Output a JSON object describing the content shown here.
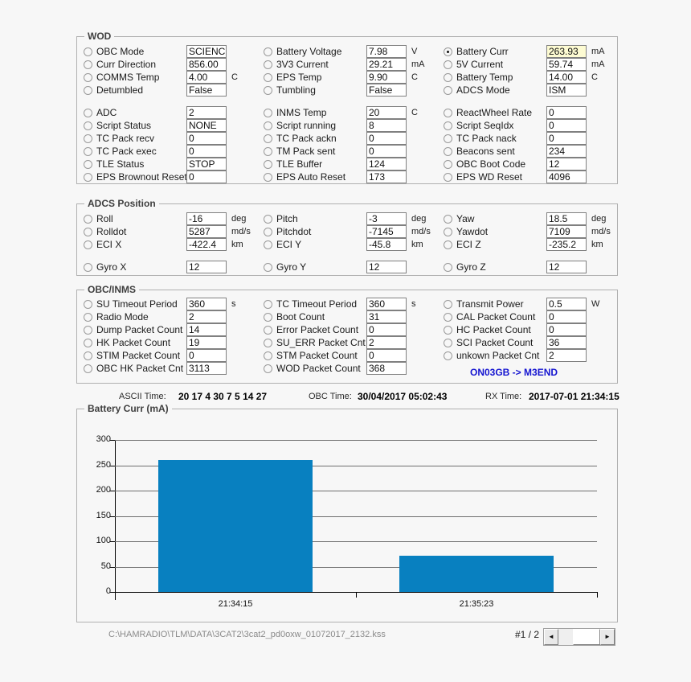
{
  "wod": {
    "legend": "WOD",
    "col1": [
      {
        "label": "OBC Mode",
        "value": "SCIENCE"
      },
      {
        "label": "Curr Direction",
        "value": "856.00"
      },
      {
        "label": "COMMS Temp",
        "value": "4.00",
        "unit": "C"
      },
      {
        "label": "Detumbled",
        "value": "False"
      },
      {
        "label": "ADC",
        "value": "2"
      },
      {
        "label": "Script Status",
        "value": "NONE"
      },
      {
        "label": "TC Pack recv",
        "value": "0"
      },
      {
        "label": "TC Pack exec",
        "value": "0"
      },
      {
        "label": "TLE Status",
        "value": "STOP"
      },
      {
        "label": "EPS Brownout Reset",
        "value": "0"
      }
    ],
    "col2": [
      {
        "label": "Battery Voltage",
        "value": "7.98",
        "unit": "V"
      },
      {
        "label": "3V3 Current",
        "value": "29.21",
        "unit": "mA"
      },
      {
        "label": "EPS Temp",
        "value": "9.90",
        "unit": "C"
      },
      {
        "label": "Tumbling",
        "value": "False"
      },
      {
        "label": "INMS Temp",
        "value": "20",
        "unit": "C"
      },
      {
        "label": "Script running",
        "value": "8"
      },
      {
        "label": "TC Pack ackn",
        "value": "0"
      },
      {
        "label": "TM Pack sent",
        "value": "0"
      },
      {
        "label": "TLE Buffer",
        "value": "124"
      },
      {
        "label": "EPS Auto Reset",
        "value": "173"
      }
    ],
    "col3": [
      {
        "label": "Battery Curr",
        "value": "263.93",
        "unit": "mA",
        "selected": true
      },
      {
        "label": "5V Current",
        "value": "59.74",
        "unit": "mA"
      },
      {
        "label": "Battery Temp",
        "value": "14.00",
        "unit": "C"
      },
      {
        "label": "ADCS Mode",
        "value": "ISM"
      },
      {
        "label": "ReactWheel Rate",
        "value": "0"
      },
      {
        "label": "Script SeqIdx",
        "value": "0"
      },
      {
        "label": "TC Pack nack",
        "value": "0"
      },
      {
        "label": "Beacons sent",
        "value": "234"
      },
      {
        "label": "OBC Boot Code",
        "value": "12"
      },
      {
        "label": "EPS WD Reset",
        "value": "4096"
      }
    ]
  },
  "adcs": {
    "legend": "ADCS Position",
    "col1": [
      {
        "label": "Roll",
        "value": "-16",
        "unit": "deg"
      },
      {
        "label": "Rolldot",
        "value": "5287",
        "unit": "md/s"
      },
      {
        "label": "ECI X",
        "value": "-422.4",
        "unit": "km"
      },
      {
        "label": "Gyro X",
        "value": "12"
      }
    ],
    "col2": [
      {
        "label": "Pitch",
        "value": "-3",
        "unit": "deg"
      },
      {
        "label": "Pitchdot",
        "value": "-7145",
        "unit": "md/s"
      },
      {
        "label": "ECI Y",
        "value": "-45.8",
        "unit": "km"
      },
      {
        "label": "Gyro Y",
        "value": "12"
      }
    ],
    "col3": [
      {
        "label": "Yaw",
        "value": "18.5",
        "unit": "deg"
      },
      {
        "label": "Yawdot",
        "value": "7109",
        "unit": "md/s"
      },
      {
        "label": "ECI Z",
        "value": "-235.2",
        "unit": "km"
      },
      {
        "label": "Gyro Z",
        "value": "12"
      }
    ]
  },
  "obcinms": {
    "legend": "OBC/INMS",
    "link": "ON03GB -> M3END",
    "col1": [
      {
        "label": "SU Timeout Period",
        "value": "360",
        "unit": "s"
      },
      {
        "label": "Radio Mode",
        "value": "2"
      },
      {
        "label": "Dump Packet Count",
        "value": "14"
      },
      {
        "label": "HK Packet Count",
        "value": "19"
      },
      {
        "label": "STIM Packet Count",
        "value": "0"
      },
      {
        "label": "OBC HK Packet Cnt",
        "value": "3113"
      }
    ],
    "col2": [
      {
        "label": "TC Timeout Period",
        "value": "360",
        "unit": "s"
      },
      {
        "label": "Boot Count",
        "value": "31"
      },
      {
        "label": "Error Packet Count",
        "value": "0"
      },
      {
        "label": "SU_ERR Packet Cnt",
        "value": "2"
      },
      {
        "label": "STM Packet Count",
        "value": "0"
      },
      {
        "label": "WOD Packet Count",
        "value": "368"
      }
    ],
    "col3": [
      {
        "label": "Transmit Power",
        "value": "0.5",
        "unit": "W"
      },
      {
        "label": "CAL Packet Count",
        "value": "0"
      },
      {
        "label": "HC Packet Count",
        "value": "0"
      },
      {
        "label": "SCI Packet Count",
        "value": "36"
      },
      {
        "label": "unkown Packet Cnt",
        "value": "2"
      }
    ]
  },
  "times": {
    "ascii_label": "ASCII Time:",
    "ascii_value": "20 17 4 30 7 5 14 27",
    "obc_label": "OBC Time:",
    "obc_value": "30/04/2017 05:02:43",
    "rx_label": "RX Time:",
    "rx_value": "2017-07-01 21:34:15"
  },
  "chart_data": {
    "type": "bar",
    "title": "Battery Curr (mA)",
    "categories": [
      "21:34:15",
      "21:35:23"
    ],
    "values": [
      260,
      72
    ],
    "xlabel": "",
    "ylabel": "",
    "ylim": [
      0,
      300
    ],
    "yticks": [
      300,
      250,
      200,
      150,
      100,
      50,
      0
    ],
    "grid": true,
    "legend": "none",
    "bar_color": "#0880c0"
  },
  "footer": {
    "filepath": "C:\\HAMRADIO\\TLM\\DATA\\3CAT2\\3cat2_pd0oxw_01072017_2132.kss",
    "page": "#1 / 2",
    "scroll_left": "◄",
    "scroll_right": "►"
  }
}
